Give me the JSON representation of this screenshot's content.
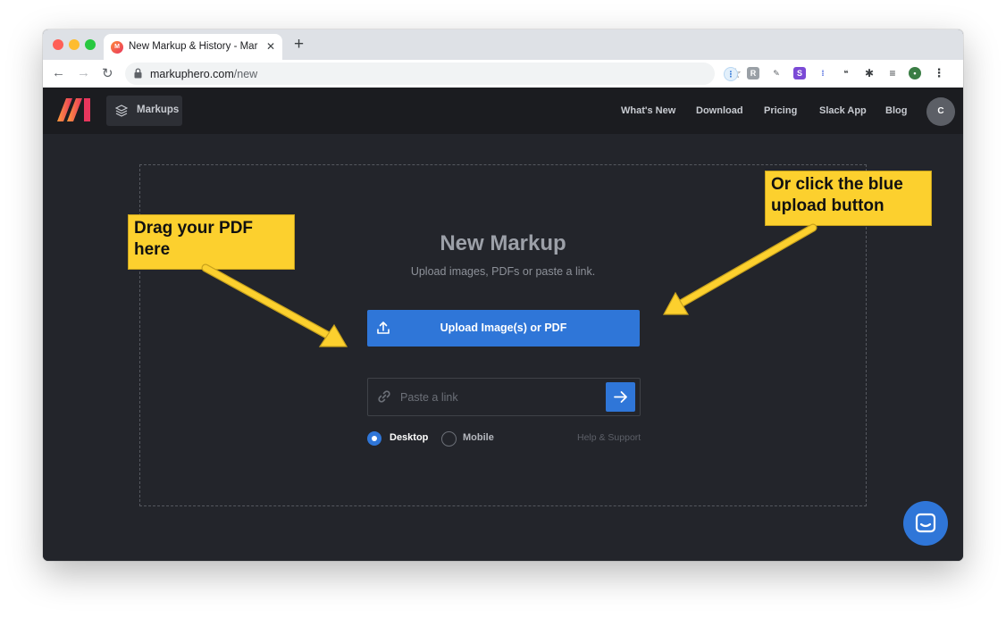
{
  "browser": {
    "tab_title": "New Markup & History - Marku",
    "url_host": "markuphero.com",
    "url_path": "/new",
    "new_tab_glyph": "+",
    "close_glyph": "✕"
  },
  "header": {
    "markups_label": "Markups",
    "nav": [
      "What's New",
      "Download",
      "Pricing",
      "Slack App",
      "Blog"
    ],
    "avatar_initial": "C"
  },
  "main": {
    "title": "New Markup",
    "subtitle": "Upload images, PDFs or paste a link.",
    "upload_label": "Upload Image(s) or PDF",
    "link_placeholder": "Paste a link",
    "device_options": [
      {
        "label": "Desktop",
        "selected": true
      },
      {
        "label": "Mobile",
        "selected": false
      }
    ],
    "help_label": "Help & Support"
  },
  "annotations": {
    "left": "Drag your PDF here",
    "right": "Or click the blue upload button"
  },
  "colors": {
    "accent": "#2f76d8",
    "callout": "#fcd02e",
    "background": "#23252b",
    "header": "#1b1c20"
  },
  "icons": [
    "lock-icon",
    "star-icon",
    "layers-icon",
    "upload-icon",
    "link-icon",
    "arrow-right-icon",
    "chat-icon"
  ]
}
